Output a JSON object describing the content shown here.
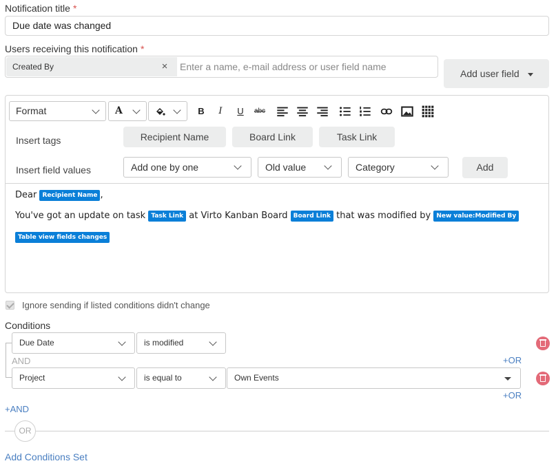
{
  "title_field": {
    "label": "Notification title",
    "required_mark": "*",
    "value": "Due date was changed"
  },
  "users_field": {
    "label": "Users receiving this notification",
    "required_mark": "*",
    "chip": "Created By",
    "chip_remove": "×",
    "placeholder": "Enter a name, e-mail address or user field name",
    "add_user_button": "Add user field"
  },
  "toolbar": {
    "format_label": "Format",
    "font_color_glyph": "A",
    "bold": "B",
    "italic": "I",
    "underline": "U",
    "strike": "abc",
    "icons": [
      "font-color-icon",
      "bg-color-icon",
      "bold-icon",
      "italic-icon",
      "underline-icon",
      "strikethrough-icon",
      "align-left-icon",
      "align-center-icon",
      "align-right-icon",
      "bullet-list-icon",
      "numbered-list-icon",
      "link-icon",
      "image-icon",
      "table-icon"
    ]
  },
  "insert_tags": {
    "label": "Insert tags",
    "buttons": [
      "Recipient Name",
      "Board Link",
      "Task Link"
    ]
  },
  "insert_field_values": {
    "label": "Insert field values",
    "mode": "Add one by one",
    "value_type": "Old value",
    "field": "Category",
    "add_button": "Add"
  },
  "message": {
    "line1_prefix": "Dear",
    "line1_tag": "Recipient Name",
    "line1_suffix": ",",
    "line2_text1": "You've got an update on task",
    "line2_tag1": "Task Link",
    "line2_text2": "at Virto Kanban Board",
    "line2_tag2": "Board Link",
    "line2_text3": "that was modified by",
    "line2_tag3": "New value:Modified By",
    "line3_tag": "Table view fields changes"
  },
  "ignore_checkbox": {
    "label": "Ignore sending if listed conditions didn't change",
    "checked": true
  },
  "conditions": {
    "title": "Conditions",
    "and_label": "AND",
    "or_link": "+OR",
    "rows": [
      {
        "field": "Due Date",
        "operator": "is modified",
        "value": ""
      },
      {
        "field": "Project",
        "operator": "is equal to",
        "value": "Own Events"
      }
    ],
    "add_and": "+AND",
    "or_divider": "OR",
    "add_set": "Add Conditions Set"
  },
  "colors": {
    "tag_blue": "#0a7fd8",
    "link_blue": "#4a7fc1",
    "required_red": "#d9534f",
    "delete_red": "#e36a78"
  }
}
